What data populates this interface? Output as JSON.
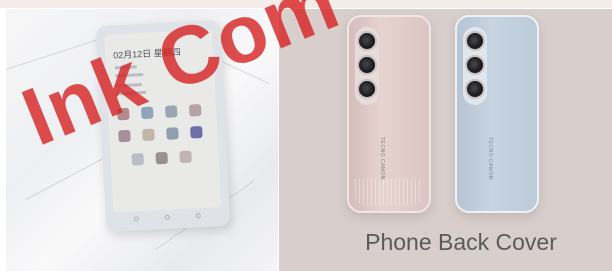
{
  "ereader": {
    "date_text": "02月12日 星期四"
  },
  "product": {
    "caption": "Phone Back Cover"
  },
  "covers": [
    {
      "color": "#dcc6c3",
      "name": "pink"
    },
    {
      "color": "#c2cfdc",
      "name": "blue"
    }
  ],
  "watermark": {
    "text": "Ink Com"
  },
  "colors": {
    "background_left": "#f1f1f3",
    "background_right": "#d8cfcd",
    "watermark": "#d61c1c",
    "caption_text": "#5a5a5a"
  }
}
